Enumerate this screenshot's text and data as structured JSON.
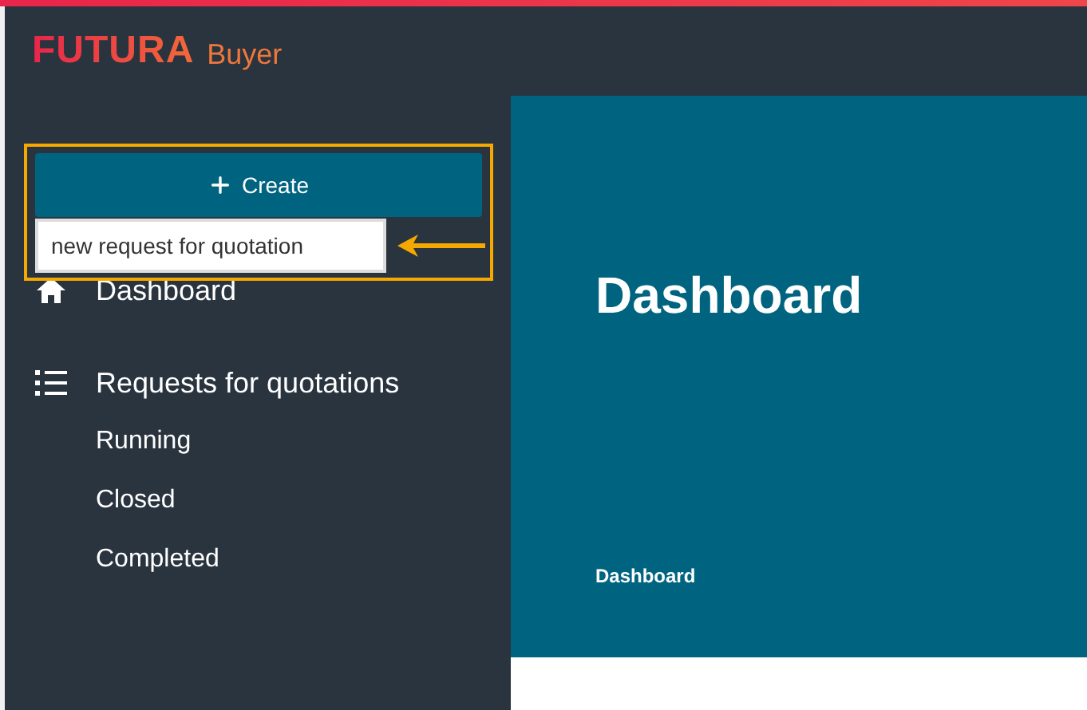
{
  "brand": {
    "name": "FUTURA",
    "product": "Buyer"
  },
  "create_button": {
    "label": "Create"
  },
  "create_menu": [
    {
      "label": "new request for quotation"
    }
  ],
  "nav": [
    {
      "kind": "home",
      "label": "Dashboard"
    },
    {
      "kind": "list",
      "label": "Requests for quotations",
      "children": [
        {
          "label": "Running"
        },
        {
          "label": "Closed"
        },
        {
          "label": "Completed"
        }
      ]
    }
  ],
  "hero": {
    "title": "Dashboard",
    "breadcrumb": "Dashboard"
  }
}
